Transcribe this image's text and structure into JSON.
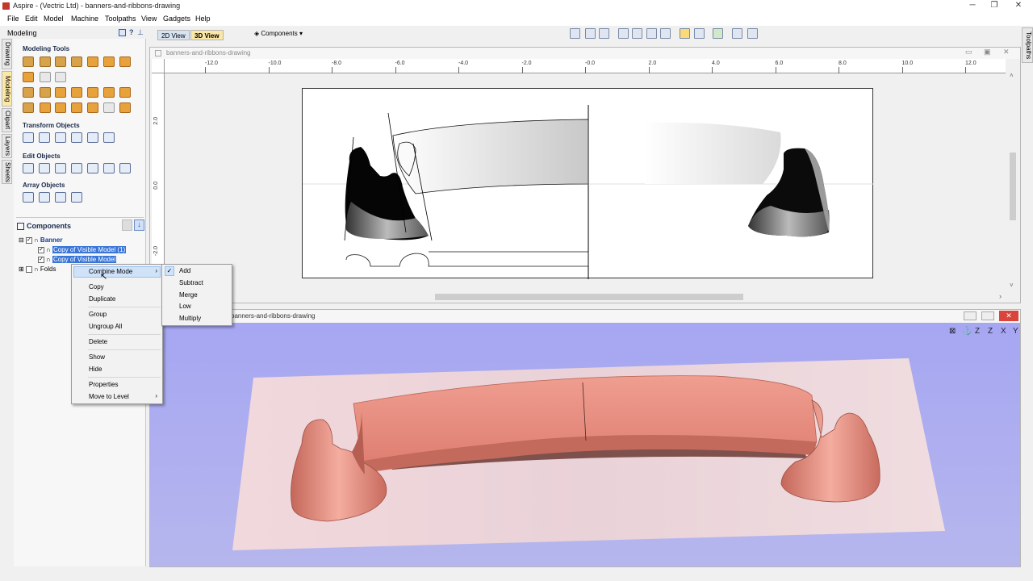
{
  "window": {
    "title": "Aspire - (Vectric Ltd) - banners-and-ribbons-drawing",
    "minimize": "─",
    "restore": "❐",
    "close": "✕"
  },
  "menubar": [
    "File",
    "Edit",
    "Model",
    "Machine",
    "Toolpaths",
    "View",
    "Gadgets",
    "Help"
  ],
  "toolbar": {
    "tab_2d": "2D View",
    "tab_3d": "3D View",
    "components_label": "Components"
  },
  "left_tabs": [
    "Drawing",
    "Modeling",
    "Clipart",
    "Layers",
    "Sheets"
  ],
  "right_tab": "Toolpaths",
  "modeling_panel": {
    "title": "Modeling",
    "sections": {
      "modeling_tools": "Modeling Tools",
      "transform_objects": "Transform Objects",
      "edit_objects": "Edit Objects",
      "array_objects": "Array Objects"
    }
  },
  "components": {
    "title": "Components",
    "tree": [
      {
        "label": "Banner",
        "level": 0,
        "selected": false
      },
      {
        "label": "Copy of Visible Model (1)",
        "level": 1,
        "selected": true
      },
      {
        "label": "Copy of Visible Model",
        "level": 1,
        "selected": true
      },
      {
        "label": "Folds",
        "level": 0,
        "selected": false
      }
    ]
  },
  "view2d": {
    "title": "banners-and-ribbons-drawing",
    "ruler_h": [
      "-12.0",
      "-10.0",
      "-8.0",
      "-6.0",
      "-4.0",
      "-2.0",
      "-0.0",
      "2.0",
      "4.0",
      "6.0",
      "8.0",
      "10.0",
      "12.0"
    ],
    "ruler_v": [
      "2.0",
      "0.0",
      "-2.0"
    ]
  },
  "view3d": {
    "title": "banners-and-ribbons-drawing"
  },
  "context_menu": {
    "items": [
      "Combine Mode",
      "Copy",
      "Duplicate",
      "Group",
      "Ungroup All",
      "Delete",
      "Show",
      "Hide",
      "Properties",
      "Move to Level"
    ],
    "submenu": [
      "Add",
      "Subtract",
      "Merge",
      "Low",
      "Multiply"
    ],
    "checked": "Add",
    "check_mark": "✓",
    "arrow": "›"
  },
  "colors": {
    "banner_3d": "#e98c7c",
    "background_3d": "#a8a8f0",
    "selection": "#3875d7",
    "active_tab": "#fbe7a6"
  }
}
